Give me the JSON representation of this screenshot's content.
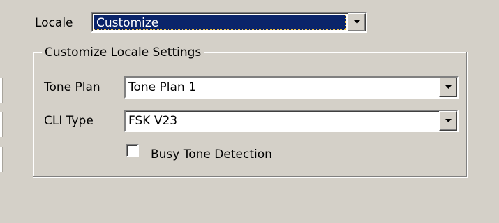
{
  "locale": {
    "label": "Locale",
    "value": "Customize"
  },
  "group": {
    "title": "Customize Locale Settings",
    "tone_plan": {
      "label": "Tone Plan",
      "value": "Tone Plan 1"
    },
    "cli_type": {
      "label": "CLI Type",
      "value": "FSK V23"
    },
    "busy_tone": {
      "label": "Busy Tone Detection",
      "checked": false
    }
  },
  "colors": {
    "background": "#d4d0c8",
    "selection": "#0a246a"
  }
}
